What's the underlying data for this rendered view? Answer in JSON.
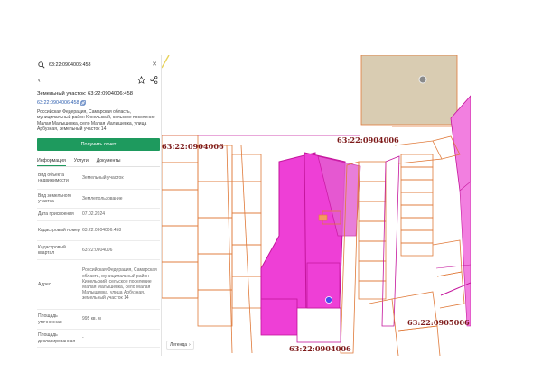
{
  "search": {
    "value": "63:22:0904006:458"
  },
  "panel": {
    "title": "Земельный участок: 63:22:0904006:458",
    "number_link": "63:22:0904006:458",
    "address": "Российская Федерация, Самарская область, муниципальный район Кинельский, сельское поселение Малая Малышевка, село Малая Малышевка, улица Арбузная, земельный участок 14",
    "report_button": "Получить отчет",
    "tabs": [
      "Информация",
      "Услуги",
      "Документы"
    ],
    "attributes": [
      {
        "label": "Вид объекта недвижимости",
        "value": "Земельный участок"
      },
      {
        "label": "Вид земельного участка",
        "value": "Землепользование"
      },
      {
        "label": "Дата присвоения",
        "value": "07.02.2024"
      },
      {
        "label": "Кадастровый номер",
        "value": "63:22:0904006:458"
      },
      {
        "label": "Кадастровый квартал",
        "value": "63:22:0904006"
      },
      {
        "label": "Адрес",
        "value": "Российская Федерация, Самарская область, муниципальный район Кинельский, сельское поселение Малая Малышевка, село Малая Малышевка, улица Арбузная, земельный участок 14"
      },
      {
        "label": "Площадь уточненная",
        "value": "995 кв. м"
      },
      {
        "label": "Площадь декларированная",
        "value": "-"
      }
    ]
  },
  "map": {
    "legend_label": "Легенда",
    "cadastral_labels": [
      "63:22:0904006",
      "63:22:0904006",
      "63:22:0905006",
      "63:22:0904006"
    ]
  },
  "colors": {
    "accent_green": "#1e9a5e",
    "parcel_border": "#e2703a",
    "selected_fill": "#ee3fd6",
    "quarter_border": "#c4169c",
    "label_color": "#7d1a1a"
  }
}
